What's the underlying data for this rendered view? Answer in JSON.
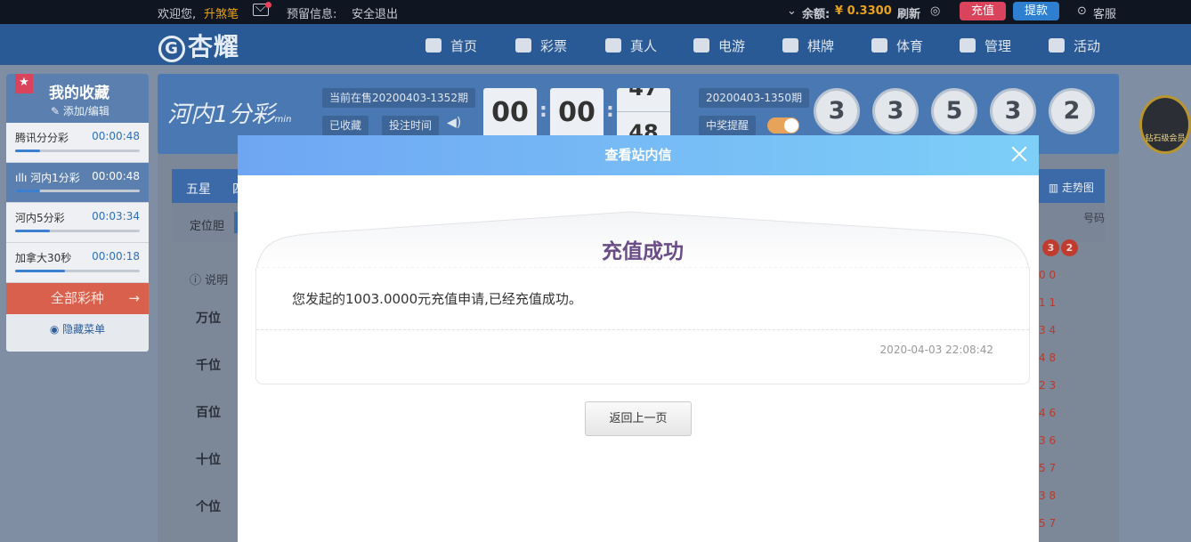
{
  "topbar": {
    "welcome": "欢迎您,",
    "username": "升煞笔",
    "reserve_info": "预留信息:",
    "logout": "安全退出",
    "balance_label": "余额:",
    "balance_value": "¥ 0.3300",
    "refresh": "刷新",
    "recharge": "充值",
    "withdraw": "提款",
    "service": "客服"
  },
  "nav": {
    "logo_text": "杏耀",
    "logo_glyph": "G",
    "items": [
      {
        "label": "首页",
        "icon": "home-icon"
      },
      {
        "label": "彩票",
        "icon": "ticket-icon"
      },
      {
        "label": "真人",
        "icon": "person-icon"
      },
      {
        "label": "电游",
        "icon": "slot-icon"
      },
      {
        "label": "棋牌",
        "icon": "cards-icon"
      },
      {
        "label": "体育",
        "icon": "trophy-icon"
      },
      {
        "label": "管理",
        "icon": "users-icon"
      },
      {
        "label": "活动",
        "icon": "gift-icon"
      }
    ]
  },
  "favorites": {
    "title": "我的收藏",
    "edit": "添加/编辑",
    "items": [
      {
        "name": "腾讯分分彩",
        "time": "00:00:48",
        "progress": 0.2,
        "active": false
      },
      {
        "name": "河内1分彩",
        "time": "00:00:48",
        "progress": 0.2,
        "active": true
      },
      {
        "name": "河内5分彩",
        "time": "00:03:34",
        "progress": 0.28,
        "active": false
      },
      {
        "name": "加拿大30秒",
        "time": "00:00:18",
        "progress": 0.4,
        "active": false
      }
    ],
    "all_lotteries": "全部彩种",
    "hide_menu": "隐藏菜单"
  },
  "game": {
    "logo": "河内1分彩",
    "logo_sub": "min",
    "current_period": "当前在售20200403-1352期",
    "favorited": "已收藏",
    "bet_time": "投注时间",
    "countdown": [
      "00",
      "00",
      "47"
    ],
    "countdown_bottom": "48",
    "last_period": "20200403-1350期",
    "win_alert": "中奖提醒",
    "balls": [
      "3",
      "3",
      "5",
      "3",
      "2"
    ],
    "badge": "钻石级会员"
  },
  "board": {
    "tab1": "五星",
    "tab2": "四",
    "trend": "走势图",
    "locator": "定位胆",
    "hotcold": "号码",
    "note": "说明",
    "positions": [
      "万位",
      "千位",
      "百位",
      "十位",
      "个位"
    ],
    "recent_balls": [
      "3",
      "2"
    ],
    "history": [
      "0 0",
      "1 1",
      "3 4",
      "4 8",
      "2 3",
      "4 6",
      "3 6",
      "5 7",
      "3 8",
      "5 7"
    ]
  },
  "modal": {
    "title": "查看站内信",
    "heading": "充值成功",
    "message": "您发起的1003.0000元充值申请,已经充值成功。",
    "time": "2020-04-03 22:08:42",
    "back": "返回上一页"
  }
}
